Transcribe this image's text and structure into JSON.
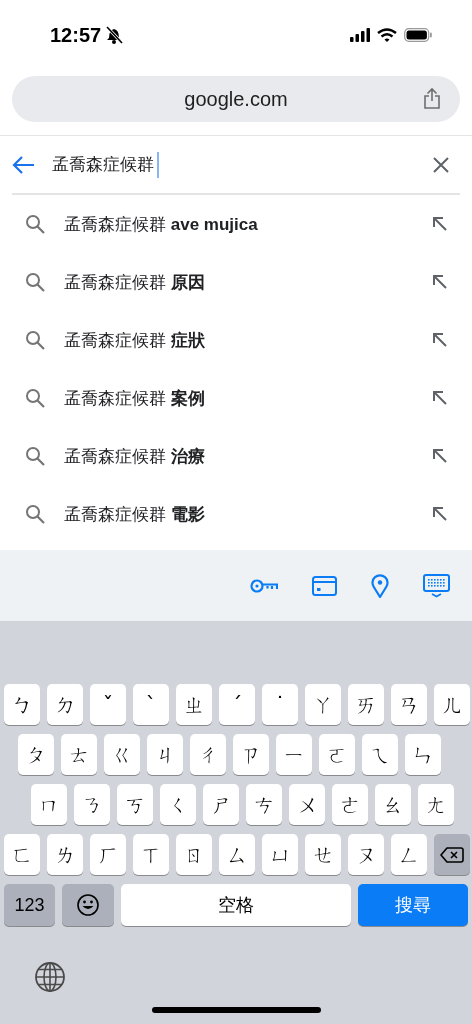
{
  "status_bar": {
    "time": "12:57",
    "silent": true
  },
  "address_bar": {
    "url": "google.com"
  },
  "search": {
    "value": "孟喬森症候群",
    "focused": true
  },
  "suggestions": [
    {
      "text": "孟喬森症候群 **ave mujica**"
    },
    {
      "text": "孟喬森症候群 **原因**"
    },
    {
      "text": "孟喬森症候群 **症狀**"
    },
    {
      "text": "孟喬森症候群 **案例**"
    },
    {
      "text": "孟喬森症候群 **治療**"
    },
    {
      "text": "孟喬森症候群 **電影**"
    }
  ],
  "keyboard": {
    "rows": [
      [
        "ㄅ",
        "ㄉ",
        "ˇ",
        "ˋ",
        "ㄓ",
        "ˊ",
        "˙",
        "ㄚ",
        "ㄞ",
        "ㄢ",
        "ㄦ"
      ],
      [
        "ㄆ",
        "ㄊ",
        "ㄍ",
        "ㄐ",
        "ㄔ",
        "ㄗ",
        "ㄧ",
        "ㄛ",
        "ㄟ",
        "ㄣ"
      ],
      [
        "ㄇ",
        "ㄋ",
        "ㄎ",
        "ㄑ",
        "ㄕ",
        "ㄘ",
        "ㄨ",
        "ㄜ",
        "ㄠ",
        "ㄤ"
      ],
      [
        "ㄈ",
        "ㄌ",
        "ㄏ",
        "ㄒ",
        "ㄖ",
        "ㄙ",
        "ㄩ",
        "ㄝ",
        "ㄡ",
        "ㄥ"
      ]
    ],
    "numbers_key": "123",
    "space_key": "空格",
    "action_key": "搜尋"
  }
}
